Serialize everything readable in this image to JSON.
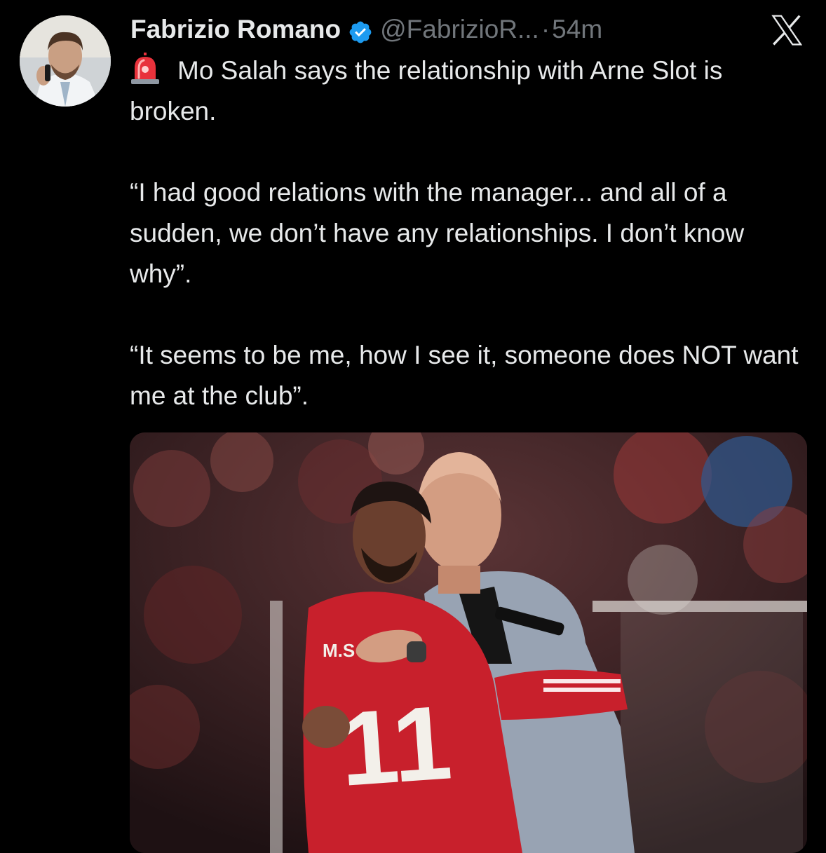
{
  "tweet": {
    "author": {
      "display_name": "Fabrizio Romano",
      "handle": "@FabrizioR...",
      "verified": true,
      "avatar_icon": "profile-photo"
    },
    "separator": "·",
    "timestamp": "54m",
    "platform_icon": "x-logo-icon",
    "siren_icon": "rotating-light-emoji",
    "paragraphs": [
      "Mo Salah says the relationship with Arne Slot is broken.",
      "“I had good relations with the manager... and all of a sudden, we don’t have any relationships. I don’t know why”.",
      "“It seems to be me, how I see it, someone does NOT want me at the club”."
    ],
    "media": {
      "shirt_name": "M.S",
      "shirt_number": "11"
    }
  },
  "colors": {
    "background": "#000000",
    "text_primary": "#e7e9ea",
    "text_secondary": "#71767b",
    "verified_blue": "#1d9bf0"
  }
}
